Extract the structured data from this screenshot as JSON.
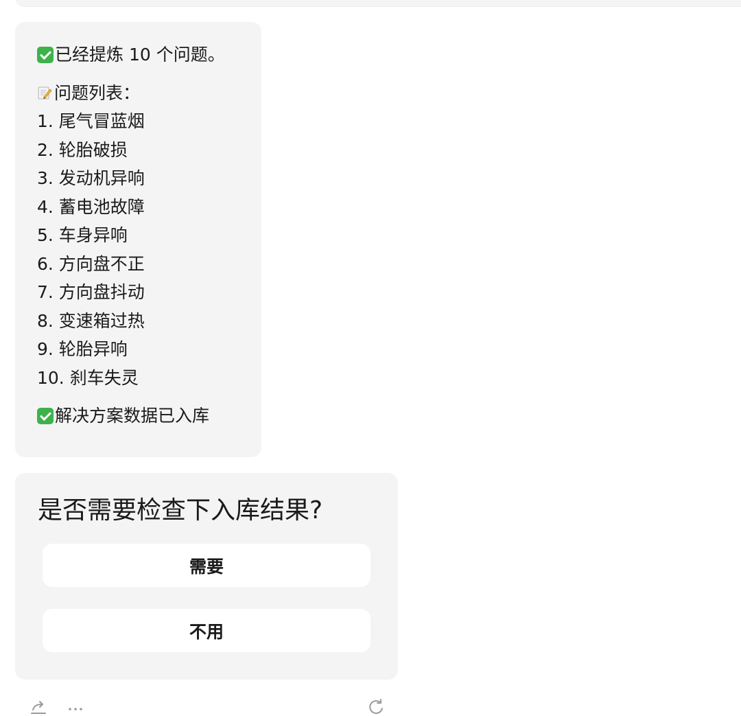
{
  "summary": {
    "extracted_text": "已经提炼 10 个问题。",
    "list_header": "问题列表：",
    "items": [
      "1. 尾气冒蓝烟",
      "2. 轮胎破损",
      "3. 发动机异响",
      "4. 蓄电池故障",
      "5. 车身异响",
      "6. 方向盘不正",
      "7. 方向盘抖动",
      "8. 变速箱过热",
      "9. 轮胎异响",
      "10. 刹车失灵"
    ],
    "stored_text": "解决方案数据已入库"
  },
  "question": {
    "title": "是否需要检查下入库结果?",
    "options": [
      "需要",
      "不用"
    ]
  },
  "icons": {
    "check": "check-mark-button-icon",
    "memo": "memo-icon",
    "share": "share-icon",
    "more": "more-icon",
    "refresh": "refresh-icon"
  },
  "colors": {
    "bubble_bg": "#f4f4f5",
    "check_green": "#3db24b",
    "icon_gray": "#9a9a9a"
  }
}
